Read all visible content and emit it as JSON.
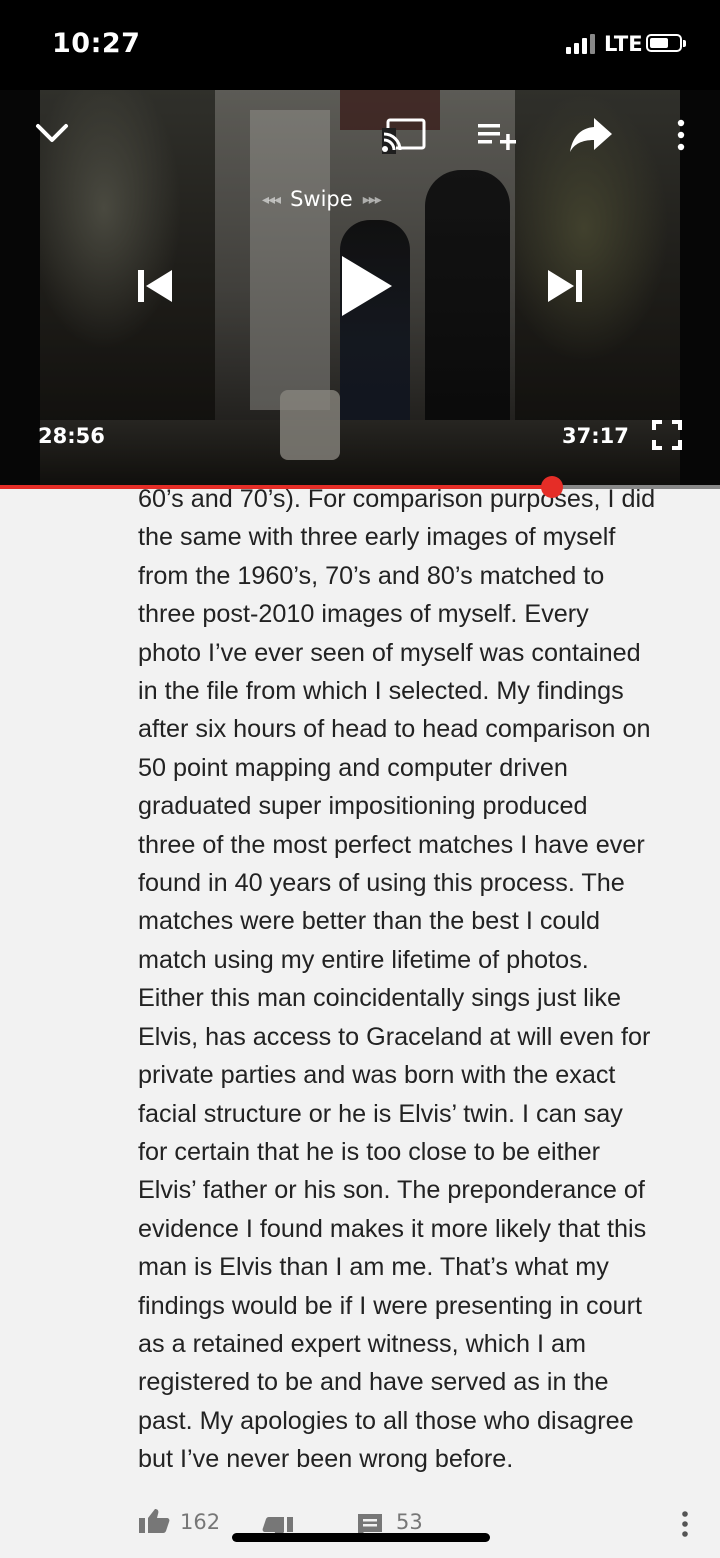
{
  "status_bar": {
    "time": "10:27",
    "network": "LTE"
  },
  "player": {
    "swipe_label": "Swipe",
    "current_time": "28:56",
    "total_time": "37:17",
    "progress_fraction": 0.766,
    "icons": [
      "chevron-down-icon",
      "cast-icon",
      "add-to-queue-icon",
      "share-icon",
      "more-vert-icon",
      "previous-icon",
      "play-icon",
      "next-icon",
      "fullscreen-icon"
    ]
  },
  "comment": {
    "lines": [
      "60’s and 70’s). For comparison purposes, I did",
      "the same with three early images of myself",
      "from the 1960’s, 70’s and 80’s matched to",
      "three post-2010 images of myself. Every",
      "photo I’ve ever seen of myself was contained",
      "in the file from which I selected. My findings",
      "after six hours of head to head comparison on",
      "50 point mapping and computer driven",
      "graduated super impositioning produced",
      "three of the most perfect matches I have ever",
      "found in 40 years of using this process. The",
      "matches were better than the best I could",
      "match using my entire lifetime of photos.",
      "Either this man coincidentally sings just like",
      "Elvis, has access to Graceland at will even for",
      "private parties and was born with the exact",
      "facial structure or he is Elvis’ twin. I can say",
      "for certain that he is too close to be either",
      "Elvis’ father or his son. The preponderance of",
      "evidence I found makes it more likely that this",
      "man is Elvis than I am me. That’s what my",
      "findings would be if I were presenting in court",
      "as a retained expert witness, which I am",
      "registered to be and have served as in the",
      "past. My apologies to all those who disagree",
      "but I’ve never been wrong before."
    ]
  },
  "actions": {
    "likes": "162",
    "replies": "53"
  }
}
